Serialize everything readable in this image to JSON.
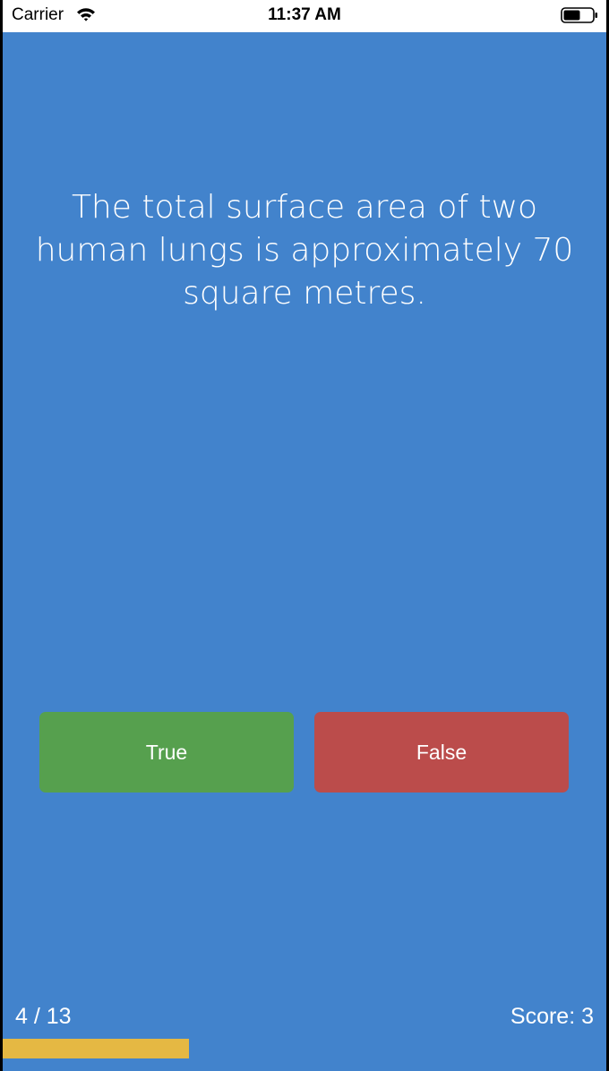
{
  "status_bar": {
    "carrier": "Carrier",
    "time": "11:37 AM",
    "wifi_icon": "wifi-icon",
    "battery_icon": "battery-icon"
  },
  "quiz": {
    "question": "The total surface area of two human lungs is approximately 70 square metres.",
    "true_label": "True",
    "false_label": "False",
    "progress_text": "4 / 13",
    "score_text": "Score: 3",
    "progress_fraction": 0.308
  },
  "colors": {
    "background": "#4283cc",
    "true_button": "#56a04e",
    "false_button": "#bb4c4b",
    "progress_bar": "#e5b843"
  }
}
